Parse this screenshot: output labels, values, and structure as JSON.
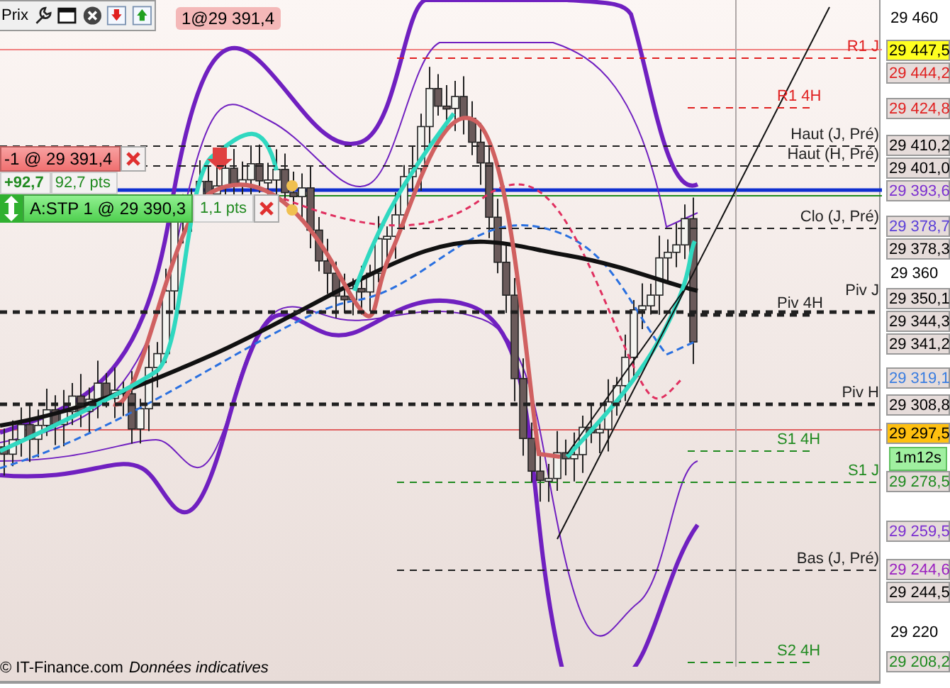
{
  "toolbar": {
    "label": "Prix"
  },
  "order_badge": "1@29 391,4",
  "position": {
    "text": "-1 @ 29 391,4",
    "gain": "+92,7",
    "points": "92,7 pts"
  },
  "stop_order": {
    "text": "A:STP 1 @ 29 390,3",
    "distance": "1,1 pts"
  },
  "price_axis": {
    "ticks": [
      "29 460",
      "29 360",
      "29 220"
    ]
  },
  "levels": [
    {
      "label": "R1 J",
      "color": "#e02020",
      "kind": "right",
      "bold": false
    },
    {
      "label": "R1 4H",
      "color": "#e02020",
      "kind": "short",
      "bold": false
    },
    {
      "label": "Haut (J, Pré)",
      "color": "#202020",
      "kind": "full",
      "bold": false
    },
    {
      "label": "Haut (H, Pré)",
      "color": "#202020",
      "kind": "full",
      "bold": false
    },
    {
      "label": "Clo (J, Pré)",
      "color": "#202020",
      "kind": "right",
      "bold": false
    },
    {
      "label": "Piv J",
      "color": "#202020",
      "kind": "full",
      "bold": true
    },
    {
      "label": "Piv 4H",
      "color": "#202020",
      "kind": "short",
      "bold": true
    },
    {
      "label": "Piv H",
      "color": "#202020",
      "kind": "full",
      "bold": true
    },
    {
      "label": "S1 4H",
      "color": "#208a20",
      "kind": "short",
      "bold": false
    },
    {
      "label": "S1 J",
      "color": "#208a20",
      "kind": "right",
      "bold": false
    },
    {
      "label": "Bas (J, Pré)",
      "color": "#202020",
      "kind": "right",
      "bold": false
    },
    {
      "label": "S2 4H",
      "color": "#208a20",
      "kind": "short",
      "bold": false
    }
  ],
  "price_tags": [
    {
      "text": "29 447,5",
      "kind": "alert"
    },
    {
      "text": "29 444,2",
      "color": "#e02020",
      "kind": "plain"
    },
    {
      "text": "29 424,8",
      "color": "#e02020",
      "kind": "plain"
    },
    {
      "text": "29 410,2",
      "color": "#000000",
      "kind": "plain"
    },
    {
      "text": "29 401,0",
      "color": "#000000",
      "kind": "plain"
    },
    {
      "text": "29 393,6",
      "color": "#7b2fd0",
      "kind": "plain"
    },
    {
      "text": "29 378,7",
      "color": "#5a3fd8",
      "kind": "plain"
    },
    {
      "text": "29 378,3",
      "color": "#000000",
      "kind": "plain"
    },
    {
      "text": "29 350,1",
      "color": "#000000",
      "kind": "plain"
    },
    {
      "text": "29 344,3",
      "color": "#000000",
      "kind": "plain"
    },
    {
      "text": "29 341,2",
      "color": "#000000",
      "kind": "plain"
    },
    {
      "text": "29 319,1",
      "color": "#3a7de0",
      "kind": "plain"
    },
    {
      "text": "29 308,8",
      "color": "#000000",
      "kind": "plain"
    },
    {
      "text": "29 297,5",
      "kind": "current"
    },
    {
      "text": "29 278,5",
      "color": "#208a20",
      "kind": "plain"
    },
    {
      "text": "29 259,5",
      "color": "#7b2fd0",
      "kind": "plain"
    },
    {
      "text": "29 244,6",
      "color": "#9a20c0",
      "kind": "plain"
    },
    {
      "text": "29 244,5",
      "color": "#000000",
      "kind": "plain"
    },
    {
      "text": "29 208,2",
      "color": "#208a20",
      "kind": "plain"
    }
  ],
  "timer": "1m12s",
  "footer": {
    "copyright": "© IT-Finance.com",
    "note": "Données indicatives"
  }
}
